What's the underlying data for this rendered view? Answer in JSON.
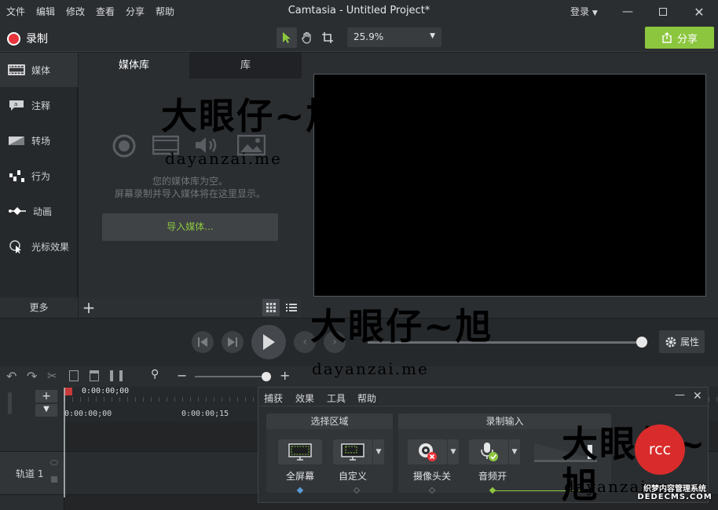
{
  "menu": [
    "文件",
    "编辑",
    "修改",
    "查看",
    "分享",
    "帮助"
  ],
  "app_title": "Camtasia - Untitled Project*",
  "login_label": "登录",
  "record_label": "录制",
  "zoom_value": "25.9%",
  "share_label": "分享",
  "nav": {
    "items": [
      {
        "label": "媒体",
        "icon": "film-icon"
      },
      {
        "label": "注释",
        "icon": "annotation-icon"
      },
      {
        "label": "转场",
        "icon": "transition-icon"
      },
      {
        "label": "行为",
        "icon": "behavior-icon"
      },
      {
        "label": "动画",
        "icon": "animation-icon"
      },
      {
        "label": "光标效果",
        "icon": "cursor-effect-icon"
      }
    ],
    "more_label": "更多"
  },
  "media_panel": {
    "tabs": [
      "媒体库",
      "库"
    ],
    "empty_line1": "您的媒体库为空。",
    "empty_line2": "屏幕录制并导入媒体将在这里显示。",
    "import_label": "导入媒体..."
  },
  "properties_label": "属性",
  "timeline": {
    "timecode_top": "0:00:00;00",
    "tick1": "0:00:00;00",
    "tick2": "0:00:00;15",
    "track_label": "轨道 1"
  },
  "recorder": {
    "menu": [
      "捕获",
      "效果",
      "工具",
      "帮助"
    ],
    "region_title": "选择区域",
    "input_title": "录制输入",
    "fullscreen_label": "全屏幕",
    "custom_label": "自定义",
    "camera_label": "摄像头关",
    "audio_label": "音频开"
  },
  "watermark": {
    "text": "大眼仔~旭",
    "url": "dayanzai.me",
    "badge": "rcc",
    "footer": "织梦内容管理系统",
    "footer_url": "DEDECMS.COM"
  },
  "colors": {
    "accent": "#8cc63f",
    "record": "#e8343a",
    "badge": "#d92b2b"
  }
}
